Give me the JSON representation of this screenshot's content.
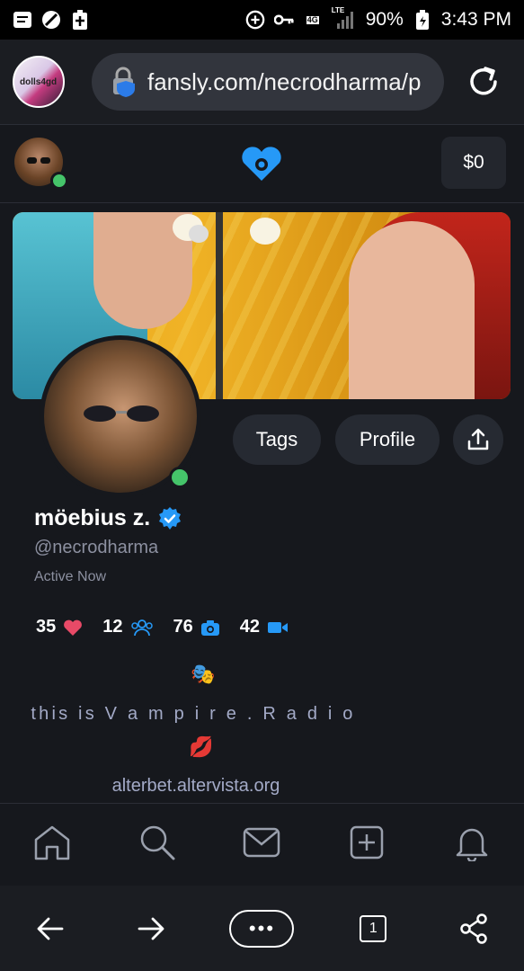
{
  "status_bar": {
    "battery": "90%",
    "time": "3:43 PM",
    "network": "4G",
    "lte": "LTE",
    "icons": [
      "message-icon",
      "no-entry-icon",
      "battery-plus-icon",
      "data-saver-icon",
      "vpn-key-icon",
      "signal-icon",
      "battery-icon"
    ]
  },
  "browser": {
    "tab_thumb_label": "dolls4gd",
    "url": "fansly.com/necrodharma/p",
    "reload_icon": "reload-icon"
  },
  "header": {
    "balance": "$0",
    "logo": "fansly-heart-logo-icon"
  },
  "profile": {
    "name": "möebius z.",
    "handle": "@necrodharma",
    "status": "Active Now",
    "actions": {
      "tags": "Tags",
      "profile": "Profile"
    },
    "stats": [
      {
        "value": "35",
        "icon": "heart-icon"
      },
      {
        "value": "12",
        "icon": "followers-icon"
      },
      {
        "value": "76",
        "icon": "camera-icon"
      },
      {
        "value": "42",
        "icon": "video-icon"
      }
    ],
    "bio": {
      "emoji1": "🎭",
      "line1": "this is V a m p i r e . R a d i o",
      "emoji2": "💋",
      "link": "alterbet.altervista.org"
    }
  },
  "bottom_nav": [
    "home-icon",
    "search-icon",
    "messages-icon",
    "create-post-icon",
    "notifications-icon"
  ],
  "browser_nav": {
    "tab_count": "1",
    "more_label": "•••"
  },
  "colors": {
    "accent": "#2699f7",
    "online": "#45c46a",
    "heart": "#e84a67",
    "background": "#16181d"
  }
}
